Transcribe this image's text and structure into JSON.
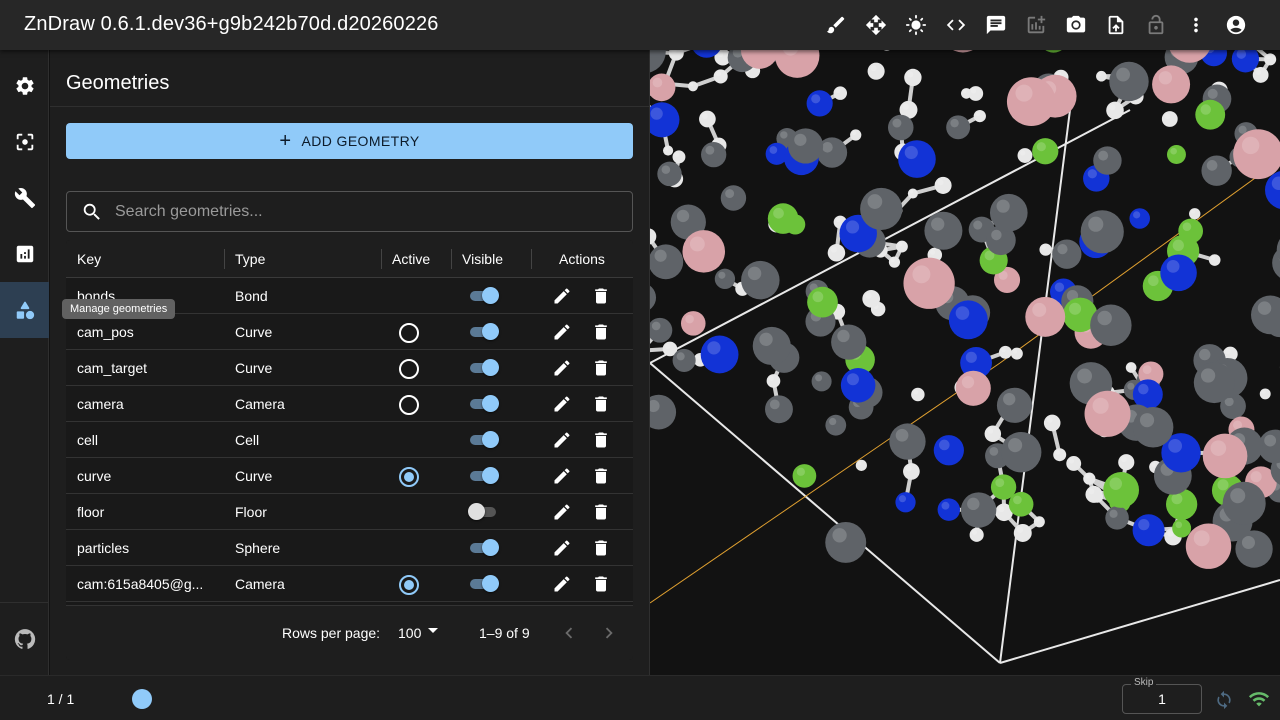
{
  "app": {
    "title": "ZnDraw 0.6.1.dev36+g9b242b70d.d20260226"
  },
  "toolbar": {
    "icons": [
      "brush-icon",
      "move-icon",
      "brightness-icon",
      "code-icon",
      "chat-icon",
      "add-chart-icon",
      "camera-icon",
      "upload-icon",
      "lock-icon",
      "more-vert-icon",
      "account-icon"
    ]
  },
  "sidebar": {
    "tooltip": "Manage geometries",
    "icons": [
      "settings-icon",
      "center-focus-icon",
      "build-icon",
      "analytics-icon",
      "geometries-icon",
      "github-icon"
    ]
  },
  "panel": {
    "title": "Geometries",
    "add_button": "ADD GEOMETRY",
    "search_placeholder": "Search geometries..."
  },
  "table": {
    "headers": {
      "key": "Key",
      "type": "Type",
      "active": "Active",
      "visible": "Visible",
      "actions": "Actions"
    },
    "rows": [
      {
        "key": "bonds",
        "type": "Bond",
        "active": "none",
        "visible": true
      },
      {
        "key": "cam_pos",
        "type": "Curve",
        "active": "unchecked",
        "visible": true
      },
      {
        "key": "cam_target",
        "type": "Curve",
        "active": "unchecked",
        "visible": true
      },
      {
        "key": "camera",
        "type": "Camera",
        "active": "unchecked",
        "visible": true
      },
      {
        "key": "cell",
        "type": "Cell",
        "active": "none",
        "visible": true
      },
      {
        "key": "curve",
        "type": "Curve",
        "active": "checked",
        "visible": true
      },
      {
        "key": "floor",
        "type": "Floor",
        "active": "none",
        "visible": false
      },
      {
        "key": "particles",
        "type": "Sphere",
        "active": "none",
        "visible": true
      },
      {
        "key": "cam:615a8405@g...",
        "type": "Camera",
        "active": "checked",
        "visible": true
      }
    ],
    "footer": {
      "rows_per_page_label": "Rows per page:",
      "rows_per_page": "100",
      "range": "1–9 of 9"
    }
  },
  "bottom": {
    "frame": "1 / 1",
    "skip_label": "Skip",
    "skip_value": "1"
  },
  "colors": {
    "accent": "#90caf9",
    "carbon": "#5f6368",
    "hydrogen": "#e8e8e8",
    "nitrogen": "#1233d6",
    "chlorine": "#6cc23a",
    "fluorine": "#d8a2a8",
    "connected": "#66bb6a"
  }
}
